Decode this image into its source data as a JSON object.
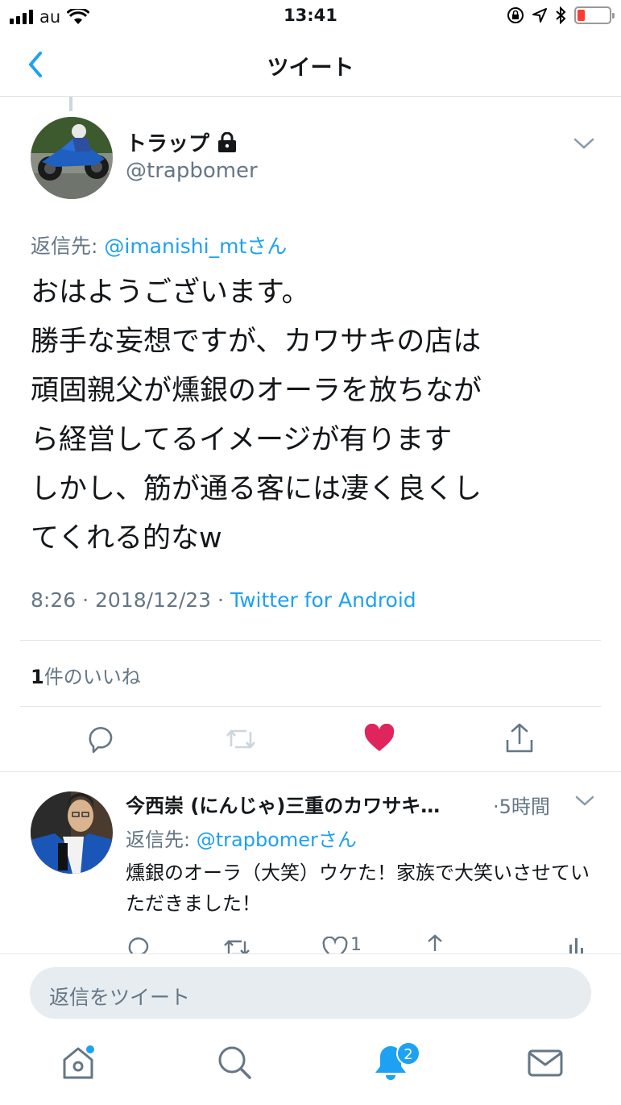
{
  "status_bar": {
    "carrier": "au",
    "time": "13:41",
    "battery_color": "#ff3b30"
  },
  "nav": {
    "title": "ツイート",
    "back_icon": "chevron-left-icon"
  },
  "tweet": {
    "display_name": "トラップ",
    "locked_icon": "lock-icon",
    "handle": "@trapbomer",
    "reply_to_prefix": "返信先: ",
    "reply_to_mention": "@imanishi_mtさん",
    "text": "おはようございます。\n勝手な妄想ですが、カワサキの店は\n頑固親父が燻銀のオーラを放ちなが\nら経営してるイメージが有ります\nしかし、筋が通る客には凄く良くし\nてくれる的なw",
    "time": "8:26",
    "date": "2018/12/23",
    "source": "Twitter for Android",
    "likes_count": "1",
    "likes_label": "件のいいね",
    "liked": true,
    "like_color": "#e0245e"
  },
  "reply": {
    "display_name": "今西崇 (にんじゃ)三重のカワサキ…",
    "time": "·5時間",
    "reply_to_prefix": "返信先: ",
    "reply_to_mention": "@trapbomerさん",
    "text": "燻銀のオーラ（大笑）ウケた！家族で大笑いさせていただきました！",
    "like_count": "1"
  },
  "composer": {
    "placeholder": "返信をツイート"
  },
  "tabbar": {
    "notifications_badge": "2",
    "accent": "#1da1f2"
  }
}
